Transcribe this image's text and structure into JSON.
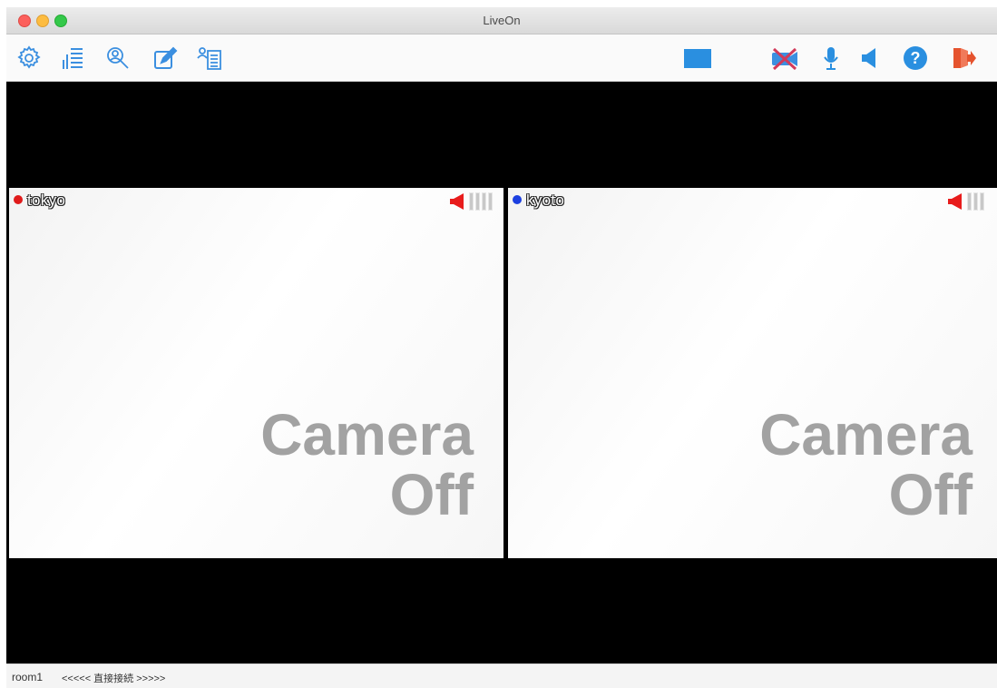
{
  "window": {
    "title": "LiveOn"
  },
  "toolbar": {
    "left_icons": [
      "gear-icon",
      "stats-list-icon",
      "user-search-icon",
      "edit-note-icon",
      "user-list-icon"
    ],
    "right_icons": [
      "screen-share-icon",
      "camera-off-icon",
      "microphone-icon",
      "speaker-icon",
      "help-icon",
      "exit-icon"
    ],
    "accent_color": "#3b8fe0",
    "camera_off_color": "#d23a5a",
    "exit_color": "#e5532e"
  },
  "participants": [
    {
      "name": "tokyo",
      "status_color": "#e01b1b",
      "camera_line1": "Camera",
      "camera_line2": "Off"
    },
    {
      "name": "kyoto",
      "status_color": "#1b3fe0",
      "camera_line1": "Camera",
      "camera_line2": "Off"
    }
  ],
  "statusbar": {
    "room": "room1",
    "connection": "<<<<< 直接接続 >>>>>"
  }
}
